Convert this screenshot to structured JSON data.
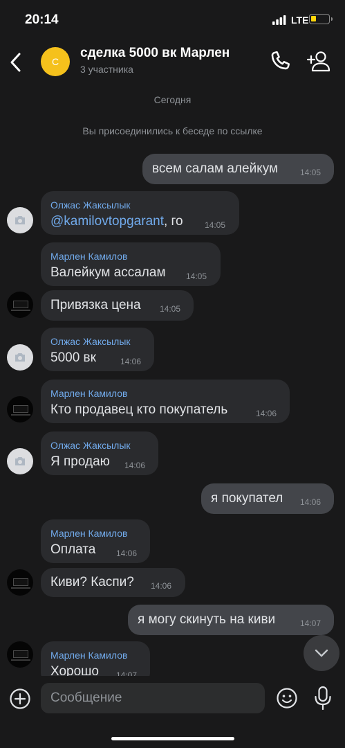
{
  "status_bar": {
    "time": "20:14",
    "network": "LTE",
    "battery_level": 0.3,
    "battery_color": "#ffd60a"
  },
  "header": {
    "avatar_letter": "С",
    "title": "сделка 5000 вк Марлен",
    "subtitle": "3 участника",
    "avatar_color": "#f5c11c",
    "icons": [
      "back-icon",
      "phone-icon",
      "add-user-icon"
    ]
  },
  "service": {
    "date": "Сегодня",
    "joined": "Вы присоединились к беседе по ссылке"
  },
  "messages": [
    {
      "dir": "out",
      "text": "всем салам алейкум",
      "time": "14:05"
    },
    {
      "dir": "in",
      "sender": "Олжас Жаксылык",
      "mention": "@kamilovtopgarant",
      "text": ", го",
      "time": "14:05",
      "avatar": "camera"
    },
    {
      "dir": "in",
      "sender": "Марлен Камилов",
      "text": "Валейкум ассалам",
      "time": "14:05"
    },
    {
      "dir": "in",
      "text": "Привязка цена",
      "time": "14:05",
      "avatar": "dark"
    },
    {
      "dir": "in",
      "sender": "Олжас Жаксылык",
      "text": "5000 вк",
      "time": "14:06",
      "avatar": "camera"
    },
    {
      "dir": "in",
      "sender": "Марлен Камилов",
      "text": "Кто продавец кто покупатель",
      "time": "14:06",
      "avatar": "dark"
    },
    {
      "dir": "in",
      "sender": "Олжас Жаксылык",
      "text": "Я продаю",
      "time": "14:06",
      "avatar": "camera"
    },
    {
      "dir": "out",
      "text": "я покупател",
      "time": "14:06"
    },
    {
      "dir": "in",
      "sender": "Марлен Камилов",
      "text": "Оплата",
      "time": "14:06"
    },
    {
      "dir": "in",
      "text": "Киви? Каспи?",
      "time": "14:06",
      "avatar": "dark"
    },
    {
      "dir": "out",
      "text": "я могу скинуть на киви",
      "time": "14:07"
    },
    {
      "dir": "in",
      "sender": "Марлен Камилов",
      "text": "Хорошо",
      "time": "14:07",
      "avatar": "dark"
    }
  ],
  "composer": {
    "placeholder": "Сообщение",
    "icons": [
      "plus-icon",
      "emoji-icon",
      "microphone-icon"
    ]
  },
  "colors": {
    "background": "#19191a",
    "incoming_bubble": "#2a2b2e",
    "outgoing_bubble": "#43454a",
    "sender_name": "#71aaeb",
    "secondary_text": "#8e9297"
  }
}
